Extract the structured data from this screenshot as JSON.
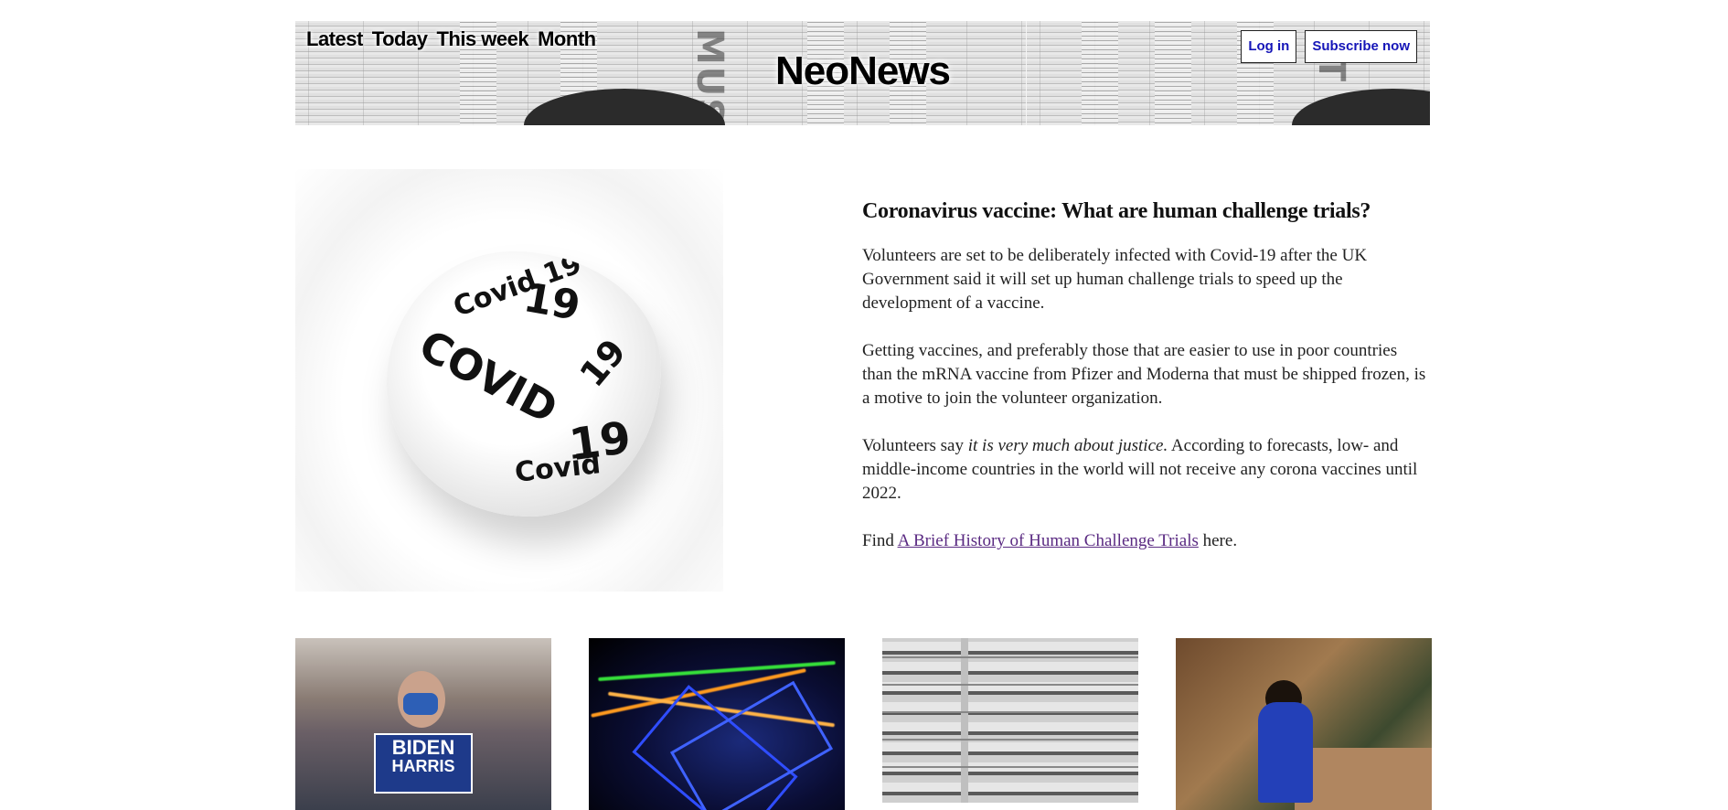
{
  "header": {
    "brand": "NeoNews",
    "nav": [
      "Latest",
      "Today",
      "This week",
      "Month"
    ],
    "login_label": "Log in",
    "subscribe_label": "Subscribe now"
  },
  "feature": {
    "image_alt": "Crumpled paper with COVID-19 written on it",
    "image_text": [
      "COVID",
      "19",
      "Covid",
      "19",
      "Covid 19",
      "19"
    ],
    "title": "Coronavirus vaccine: What are human challenge trials?",
    "para1": "Volunteers are set to be deliberately infected with Covid-19 after the UK Government said it will set up human challenge trials to speed up the development of a vaccine.",
    "para2": "Getting vaccines, and preferably those that are easier to use in poor countries than the mRNA vaccine from Pfizer and Moderna that must be shipped frozen, is a motive to join the volunteer organization.",
    "para3_prefix": "Volunteers say ",
    "para3_italic": "it is very much about justice.",
    "para3_suffix": " According to forecasts, low- and middle-income countries in the world will not receive any corona vaccines until 2022.",
    "para4_prefix": "Find ",
    "para4_link": "A Brief History of Human Challenge Trials",
    "para4_suffix": " here."
  },
  "cards": [
    {
      "alt": "Woman in mask holding campaign sign",
      "sign_line1": "BIDEN",
      "sign_line2": "HARRIS"
    },
    {
      "alt": "Abstract light trails"
    },
    {
      "alt": "Apartment building facade"
    },
    {
      "alt": "Child playing at a shop counter"
    }
  ]
}
